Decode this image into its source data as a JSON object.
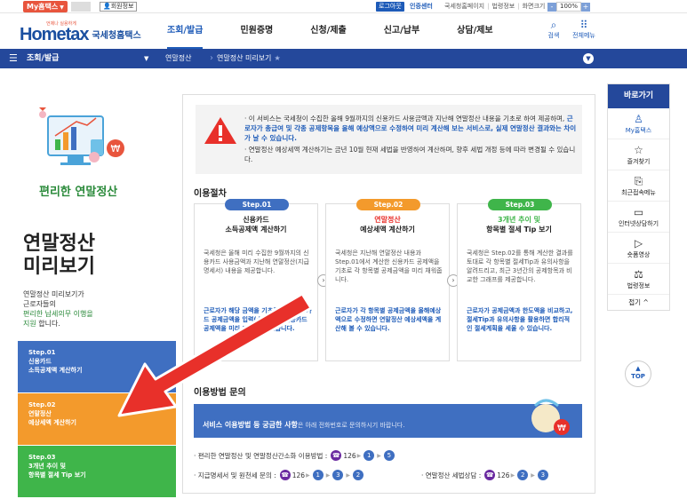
{
  "topbar": {
    "myhome": "My홈택스",
    "member_info": "회원정보",
    "logout": "로그아웃",
    "cert_center": "인증센터",
    "links": [
      "국세청홈페이지",
      "법령정보",
      "화면크기"
    ],
    "zoom": "100%",
    "zoom_minus": "-",
    "zoom_plus": "+"
  },
  "header": {
    "logo_sub": "언제나 실용하게",
    "logo_home": "Home",
    "logo_tax": "tax",
    "logo_name": "국세청홈택스",
    "nav": [
      "조회/발급",
      "민원증명",
      "신청/제출",
      "신고/납부",
      "상담/제보"
    ],
    "search": "검색",
    "all_menu": "전체메뉴"
  },
  "subnav": {
    "menu1": "조회/발급",
    "menu2": "연말정산",
    "menu3": "연말정산 미리보기"
  },
  "left": {
    "illus_title": "편리한 연말정산",
    "title_line1": "연말정산",
    "title_line2": "미리보기",
    "desc_line1": "연말정산 미리보기가",
    "desc_line2": "근로자들의",
    "desc_green": "편리한 납세의무 이행을",
    "desc_line4a": "지원",
    "desc_line4b": " 합니다.",
    "steps": [
      {
        "step": "Step.01",
        "line1": "신용카드",
        "line2": "소득공제액 계산하기"
      },
      {
        "step": "Step.02",
        "line1": "연말정산",
        "line2": "예상세액 계산하기"
      },
      {
        "step": "Step.03",
        "line1": "3개년 추이 및",
        "line2": "항목별 절세 Tip 보기"
      }
    ]
  },
  "notice": {
    "p1a": "· 이 서비스는 국세청이 수집한 올해 9월까지의 신용카드 사용금액과 지난해 연말정산 내용을 기초로 하여 제공하며, ",
    "p1b": "근로자가 총급여 및 각종 공제항목을 올해 예상액으로 수정하여 미리 계산해 보는 서비스로, 실제 연말정산 결과와는 차이가 날 수 있습니다.",
    "p2": "· 연말정산 예상세액 계산하기는 금년 10월 현재 세법을 반영하여 계산하며, 향후 세법 개정 등에 따라 변경될 수 있습니다."
  },
  "procedure": {
    "title": "이용절차",
    "cards": [
      {
        "badge": "Step.01",
        "head1": "신용카드",
        "head2": "소득공제액 계산하기",
        "body": "국세청은 올해 미리 수집한 9월까지의 신용카드 사용금액과 지난해 연말정산(지급명세서) 내용을 제공합니다.",
        "foot": "근로자가 해당 금액을 기초로 해당 신용카드 공제금액을 입력(수정)하면 신용카드 공제액을 미리 예상할 수 있습니다."
      },
      {
        "badge": "Step.02",
        "head1": "연말정산",
        "head2": "예상세액 계산하기",
        "body": "국세청은 지난해 연말정산 내용과 Step.01에서 계산한 신용카드 공제액을 기초로 각 항목별 공제금액을 미리 채워줍니다.",
        "foot": "근로자가 각 항목별 공제금액을 올해예상액으로 수정하면 연말정산 예상세액을 계산해 볼 수 있습니다."
      },
      {
        "badge": "Step.03",
        "head1": "3개년 추이 및",
        "head2": "항목별 절세 Tip 보기",
        "body": "국세청은 Step.02를 통해 계산한 결과를 토대로 각 항목별 절세Tip과 유의사항을 알려드리고, 최근 3년간의 공제항목과 비교한 그래프를 제공합니다.",
        "foot": "근로자가 공제금액과 한도액을 비교하고, 절세Tip과 유의사항을 활용하면 합리적인 절세계획을 세울 수 있습니다."
      }
    ],
    "next": "›"
  },
  "inquiry": {
    "title": "이용방법 문의",
    "banner_bold": "서비스 이용방법 등 궁금한 사항",
    "banner_rest": "은 아래 전화번호로 문의하시기 바랍니다.",
    "row1_label": "· 편리한 연말정산 및 연말정산간소화 이용방법 :",
    "row1_phone": "126",
    "row1_nums": [
      "1",
      "5"
    ],
    "row2_label": "· 지급명세서 및 원천세 문의 :",
    "row2_phone": "126",
    "row2_nums": [
      "1",
      "3",
      "2"
    ],
    "row3_label": "· 연말정산 세법상담 :",
    "row3_phone": "126",
    "row3_nums": [
      "2",
      "3"
    ]
  },
  "quick": {
    "title": "바로가기",
    "items": [
      "My홈택스",
      "즐겨찾기",
      "최근접속메뉴",
      "인터넷상담하기",
      "숏폼영상",
      "법령정보"
    ],
    "fold": "접기 ^",
    "top": "TOP"
  },
  "colors": {
    "brand_blue": "#24489b",
    "accent_blue": "#1e5bb8",
    "step1": "#3f6fc1",
    "step2": "#f39a2c",
    "step3": "#3fb54a",
    "arrow_red": "#e8302a"
  }
}
